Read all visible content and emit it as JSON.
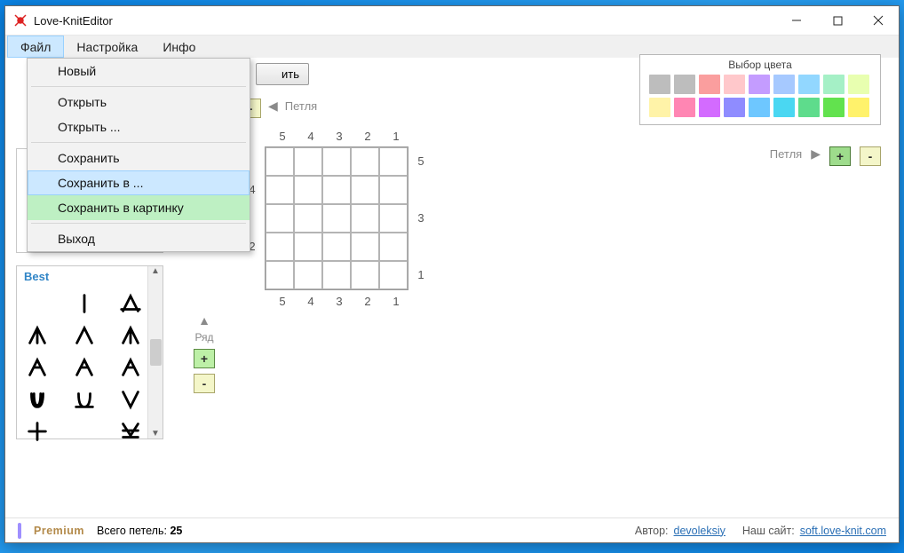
{
  "app": {
    "title": "Love-KnitEditor"
  },
  "menu": {
    "items": [
      "Файл",
      "Настройка",
      "Инфо"
    ],
    "active": 0,
    "dropdown": [
      {
        "label": "Новый"
      },
      {
        "sep": true
      },
      {
        "label": "Открыть"
      },
      {
        "label": "Открыть ..."
      },
      {
        "sep": true
      },
      {
        "label": "Сохранить"
      },
      {
        "label": "Сохранить в ...",
        "hover": true
      },
      {
        "label": "Сохранить в картинку",
        "green": true
      },
      {
        "sep": true
      },
      {
        "label": "Выход"
      }
    ]
  },
  "toolbar": {
    "partial_button": "ить"
  },
  "stitch": {
    "left_label": "Петля",
    "left_arrow": "◀",
    "right_label": "Петля",
    "right_arrow": "▶",
    "plus": "+",
    "minus": "-"
  },
  "row_controls": {
    "label": "Ряд",
    "up": "▲",
    "down": "▼",
    "plus": "+",
    "minus": "-"
  },
  "grid": {
    "cols_top": [
      "5",
      "4",
      "3",
      "2",
      "1"
    ],
    "rows_right": [
      "5",
      "",
      "3",
      "",
      "1"
    ],
    "rows_left": [
      "",
      "4",
      "",
      "2",
      ""
    ],
    "cols_bottom": [
      "5",
      "4",
      "3",
      "2",
      "1"
    ]
  },
  "colors": {
    "title": "Выбор цвета",
    "swatches": [
      "#bdbdbd",
      "#bdbdbd",
      "#fa9e9e",
      "#ffc8cb",
      "#c49cff",
      "#a6c9ff",
      "#92d7ff",
      "#a5f0c6",
      "#e8ffb0",
      "#fff3a8",
      "#ff86b3",
      "#d36bff",
      "#8f8cff",
      "#6ec7ff",
      "#4ad7f2",
      "#5edc8c",
      "#62e24e",
      "#fff26b"
    ]
  },
  "panel2_title": "Best",
  "status": {
    "premium": "Premium",
    "total_label": "Всего петель:",
    "total_value": "25",
    "author_label": "Автор:",
    "author": "devoleksiy",
    "site_label": "Наш сайт:",
    "site": "soft.love-knit.com"
  }
}
